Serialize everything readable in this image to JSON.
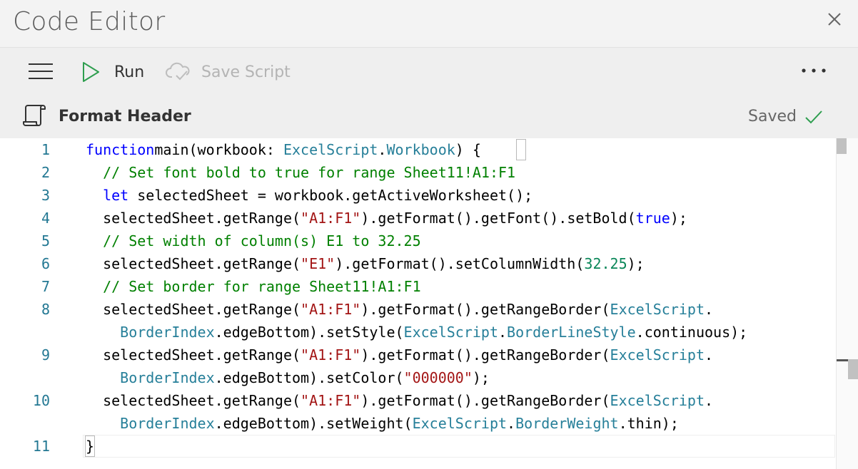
{
  "window": {
    "title": "Code Editor"
  },
  "toolbar": {
    "run_label": "Run",
    "save_label": "Save Script"
  },
  "script": {
    "name": "Format Header",
    "status": "Saved"
  },
  "colors": {
    "run_green": "#2e9e4f",
    "saved_green": "#2e9e4f",
    "line_number": "#237893"
  },
  "icons": {
    "close": "close-icon",
    "menu": "hamburger-icon",
    "run": "play-icon",
    "save": "cloud-check-icon",
    "more": "more-icon",
    "script": "script-scroll-icon",
    "saved": "checkmark-icon"
  },
  "editor": {
    "line_numbers": [
      "1",
      "2",
      "3",
      "4",
      "5",
      "6",
      "7",
      "8",
      "9",
      "10",
      "11"
    ],
    "lines": [
      [
        [
          "kw",
          "function"
        ],
        [
          "",
          "main(workbook: "
        ],
        [
          "ty",
          "ExcelScript"
        ],
        [
          "",
          "."
        ],
        [
          "ty",
          "Workbook"
        ],
        [
          "",
          ") {"
        ]
      ],
      [
        [
          "",
          "  "
        ],
        [
          "cm",
          "// Set font bold to true for range Sheet11!A1:F1"
        ]
      ],
      [
        [
          "",
          "  "
        ],
        [
          "kw",
          "let"
        ],
        [
          "",
          " selectedSheet = workbook.getActiveWorksheet();"
        ]
      ],
      [
        [
          "",
          "  selectedSheet.getRange("
        ],
        [
          "st",
          "\"A1:F1\""
        ],
        [
          "",
          ").getFormat().getFont().setBold("
        ],
        [
          "kw",
          "true"
        ],
        [
          "",
          ");"
        ]
      ],
      [
        [
          "",
          "  "
        ],
        [
          "cm",
          "// Set width of column(s) E1 to 32.25"
        ]
      ],
      [
        [
          "",
          "  selectedSheet.getRange("
        ],
        [
          "st",
          "\"E1\""
        ],
        [
          "",
          ").getFormat().setColumnWidth("
        ],
        [
          "nu",
          "32.25"
        ],
        [
          "",
          ");"
        ]
      ],
      [
        [
          "",
          "  "
        ],
        [
          "cm",
          "// Set border for range Sheet11!A1:F1"
        ]
      ],
      [
        [
          "",
          "  selectedSheet.getRange("
        ],
        [
          "st",
          "\"A1:F1\""
        ],
        [
          "",
          ").getFormat().getRangeBorder("
        ],
        [
          "ty",
          "ExcelScript"
        ],
        [
          "",
          "."
        ]
      ],
      [
        [
          "",
          "    "
        ],
        [
          "ty",
          "BorderIndex"
        ],
        [
          "",
          ".edgeBottom).setStyle("
        ],
        [
          "ty",
          "ExcelScript"
        ],
        [
          "",
          "."
        ],
        [
          "ty",
          "BorderLineStyle"
        ],
        [
          "",
          ".continuous);"
        ]
      ],
      [
        [
          "",
          "  selectedSheet.getRange("
        ],
        [
          "st",
          "\"A1:F1\""
        ],
        [
          "",
          ").getFormat().getRangeBorder("
        ],
        [
          "ty",
          "ExcelScript"
        ],
        [
          "",
          "."
        ]
      ],
      [
        [
          "",
          "    "
        ],
        [
          "ty",
          "BorderIndex"
        ],
        [
          "",
          ".edgeBottom).setColor("
        ],
        [
          "st",
          "\"000000\""
        ],
        [
          "",
          ");"
        ]
      ],
      [
        [
          "",
          "  selectedSheet.getRange("
        ],
        [
          "st",
          "\"A1:F1\""
        ],
        [
          "",
          ").getFormat().getRangeBorder("
        ],
        [
          "ty",
          "ExcelScript"
        ],
        [
          "",
          "."
        ]
      ],
      [
        [
          "",
          "    "
        ],
        [
          "ty",
          "BorderIndex"
        ],
        [
          "",
          ".edgeBottom).setWeight("
        ],
        [
          "ty",
          "ExcelScript"
        ],
        [
          "",
          "."
        ],
        [
          "ty",
          "BorderWeight"
        ],
        [
          "",
          ".thin);"
        ]
      ],
      [
        [
          "",
          "}"
        ]
      ]
    ]
  }
}
